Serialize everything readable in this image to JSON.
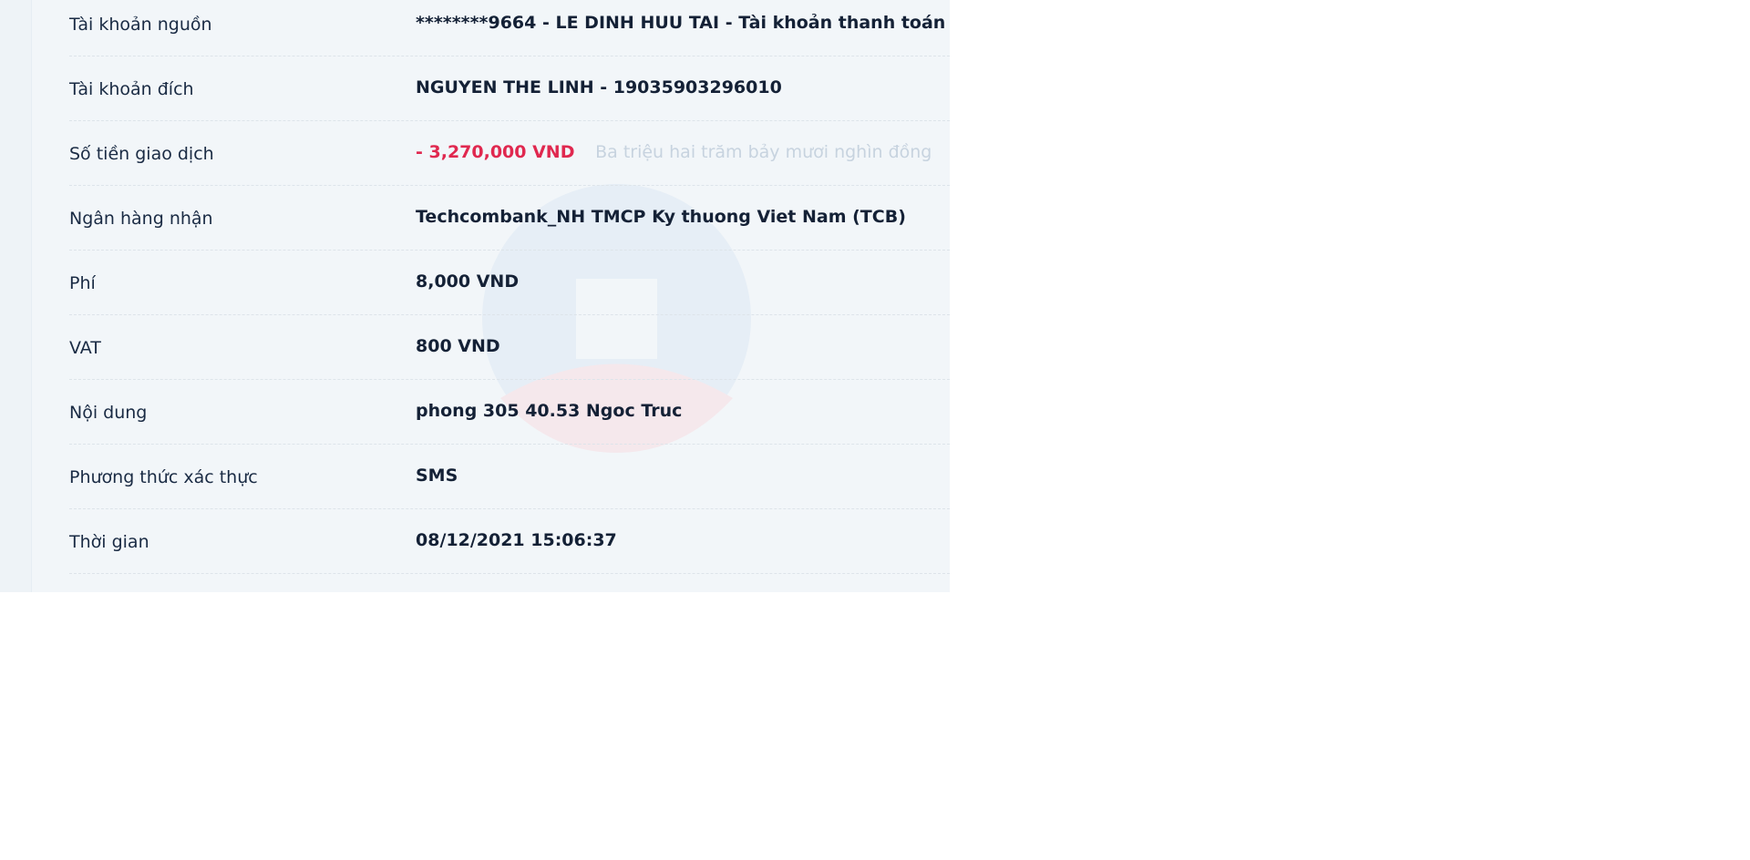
{
  "transaction": {
    "rows": [
      {
        "label": "Tài khoản nguồn",
        "value": "********9664 - LE DINH HUU TAI - Tài khoản thanh toán"
      },
      {
        "label": "Tài khoản đích",
        "value": "NGUYEN THE LINH - 19035903296010"
      },
      {
        "label": "Số tiền giao dịch",
        "amount": "- 3,270,000 VND",
        "amount_words": "Ba triệu hai trăm bảy mươi nghìn đồng"
      },
      {
        "label": "Ngân hàng nhận",
        "value": "Techcombank_NH TMCP Ky thuong Viet Nam (TCB)"
      },
      {
        "label": "Phí",
        "value": "8,000 VND"
      },
      {
        "label": "VAT",
        "value": "800 VND"
      },
      {
        "label": "Nội dung",
        "value": "phong 305 40.53 Ngoc Truc"
      },
      {
        "label": "Phương thức xác thực",
        "value": "SMS"
      },
      {
        "label": "Thời gian",
        "value": "08/12/2021 15:06:37"
      }
    ]
  },
  "icons": {
    "toggle_visibility": "eye-slash-icon",
    "watermark": "bank-logo-watermark"
  },
  "colors": {
    "panel_background": "#f2f6f9",
    "text_primary": "#142136",
    "amount_negative": "#e0284f",
    "amount_words": "#c7d3df",
    "watermark_blue": "#e3ecf5",
    "watermark_red": "#f4e6ea"
  }
}
